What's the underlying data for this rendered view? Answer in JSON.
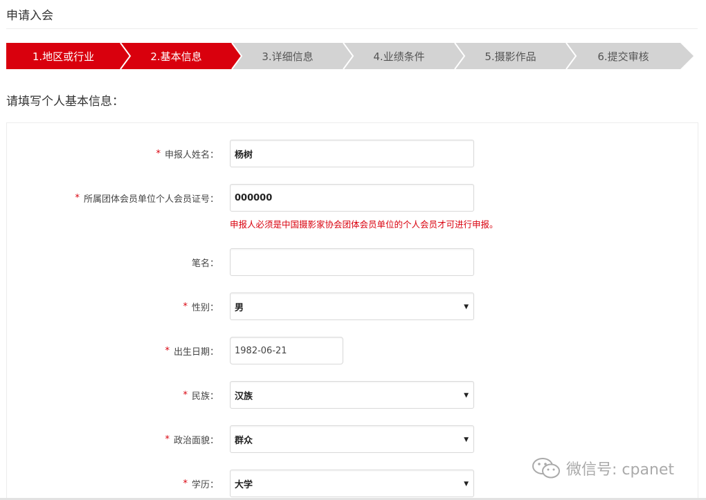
{
  "page": {
    "title": "申请入会",
    "section_heading": "请填写个人基本信息："
  },
  "steps": [
    {
      "label": "1.地区或行业",
      "active": true
    },
    {
      "label": "2.基本信息",
      "active": true
    },
    {
      "label": "3.详细信息",
      "active": false
    },
    {
      "label": "4.业绩条件",
      "active": false
    },
    {
      "label": "5.摄影作品",
      "active": false
    },
    {
      "label": "6.提交审核",
      "active": false
    }
  ],
  "colors": {
    "accent": "#d9000d",
    "step_inactive": "#d3d3d3",
    "step_separator": "#ffffff"
  },
  "form": {
    "required_mark": "*",
    "name": {
      "label": "申报人姓名：",
      "value": "杨树"
    },
    "member_no": {
      "label": "所属团体会员单位个人会员证号：",
      "value": "000000",
      "hint": "申报人必须是中国摄影家协会团体会员单位的个人会员才可进行申报。"
    },
    "pen_name": {
      "label": "笔名：",
      "value": ""
    },
    "gender": {
      "label": "性别：",
      "value": "男"
    },
    "birth_date": {
      "label": "出生日期：",
      "value": "1982-06-21"
    },
    "ethnicity": {
      "label": "民族：",
      "value": "汉族"
    },
    "political_status": {
      "label": "政治面貌：",
      "value": "群众"
    },
    "education": {
      "label": "学历：",
      "value": "大学"
    },
    "dropdown_caret": "▼"
  },
  "watermark": {
    "text": "微信号: cpanet",
    "icon": "wechat-icon"
  }
}
